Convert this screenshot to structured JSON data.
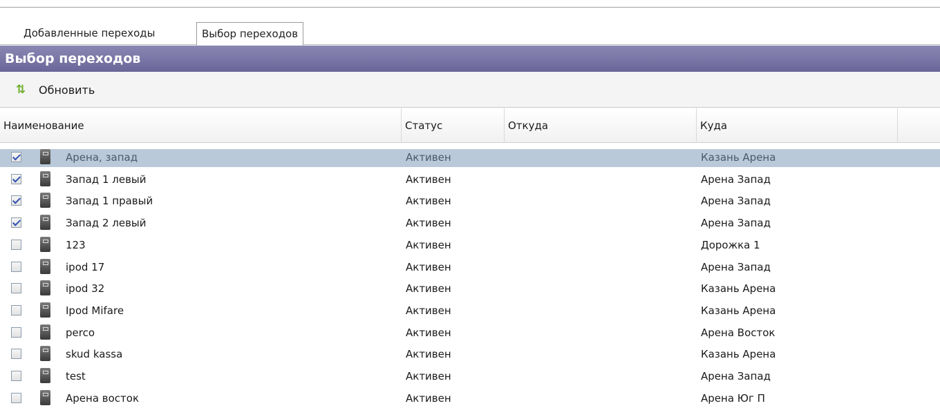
{
  "tabs": [
    {
      "label": "Добавленные переходы"
    },
    {
      "label": "Выбор переходов"
    }
  ],
  "panel": {
    "title": "Выбор переходов"
  },
  "toolbar": {
    "refresh_label": "Обновить",
    "refresh_icon": "refresh-icon"
  },
  "grid": {
    "columns": [
      "Наименование",
      "Статус",
      "Откуда",
      "Куда",
      ""
    ],
    "rows": [
      {
        "checked": true,
        "name": "Арена, запад",
        "status": "Активен",
        "from": "",
        "to": "Казань Арена"
      },
      {
        "checked": true,
        "name": "Запад 1 левый",
        "status": "Активен",
        "from": "",
        "to": "Арена Запад"
      },
      {
        "checked": true,
        "name": "Запад 1 правый",
        "status": "Активен",
        "from": "",
        "to": "Арена Запад"
      },
      {
        "checked": true,
        "name": "Запад 2 левый",
        "status": "Активен",
        "from": "",
        "to": "Арена Запад"
      },
      {
        "checked": false,
        "name": "123",
        "status": "Активен",
        "from": "",
        "to": "Дорожка 1"
      },
      {
        "checked": false,
        "name": "ipod 17",
        "status": "Активен",
        "from": "",
        "to": "Арена Запад"
      },
      {
        "checked": false,
        "name": "ipod 32",
        "status": "Активен",
        "from": "",
        "to": "Казань Арена"
      },
      {
        "checked": false,
        "name": "Ipod Mifare",
        "status": "Активен",
        "from": "",
        "to": "Казань Арена"
      },
      {
        "checked": false,
        "name": "perco",
        "status": "Активен",
        "from": "",
        "to": "Арена Восток"
      },
      {
        "checked": false,
        "name": "skud kassa",
        "status": "Активен",
        "from": "",
        "to": "Казань Арена"
      },
      {
        "checked": false,
        "name": "test",
        "status": "Активен",
        "from": "",
        "to": "Арена Запад"
      },
      {
        "checked": false,
        "name": "Арена восток",
        "status": "Активен",
        "from": "",
        "to": "Арена Юг П"
      }
    ]
  },
  "colors": {
    "header_bg": "#6a6699",
    "selected_row": "#b9c9d9",
    "refresh_icon": "#6fae2c"
  }
}
